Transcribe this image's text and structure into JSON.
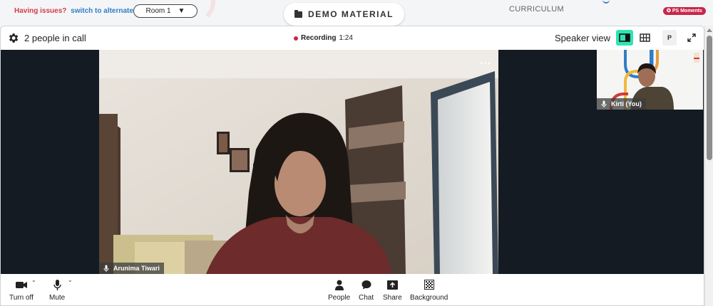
{
  "topbar": {
    "issues_text": "Having issues?",
    "switch_link": "switch to alternate room",
    "room_select_value": "Room 1",
    "demo_button_label": "DEMO MATERIAL",
    "curriculum_label": "CURRICULUM",
    "moments_badge": "PS Moments"
  },
  "call_header": {
    "people_count": "2 people in call",
    "recording_label": "Recording",
    "recording_time": "1:24",
    "view_label": "Speaker view",
    "p_button_label": "P"
  },
  "main_video": {
    "participant_name": "Arunima Tiwari"
  },
  "self_video": {
    "participant_name": "Kirti (You)"
  },
  "controls": {
    "camera_label": "Turn off",
    "mic_label": "Mute",
    "people_label": "People",
    "chat_label": "Chat",
    "share_label": "Share",
    "background_label": "Background"
  },
  "colors": {
    "accent": "#2fe4b4",
    "recording": "#c8264a",
    "link": "#2f7ec7",
    "stage": "#141b22"
  }
}
